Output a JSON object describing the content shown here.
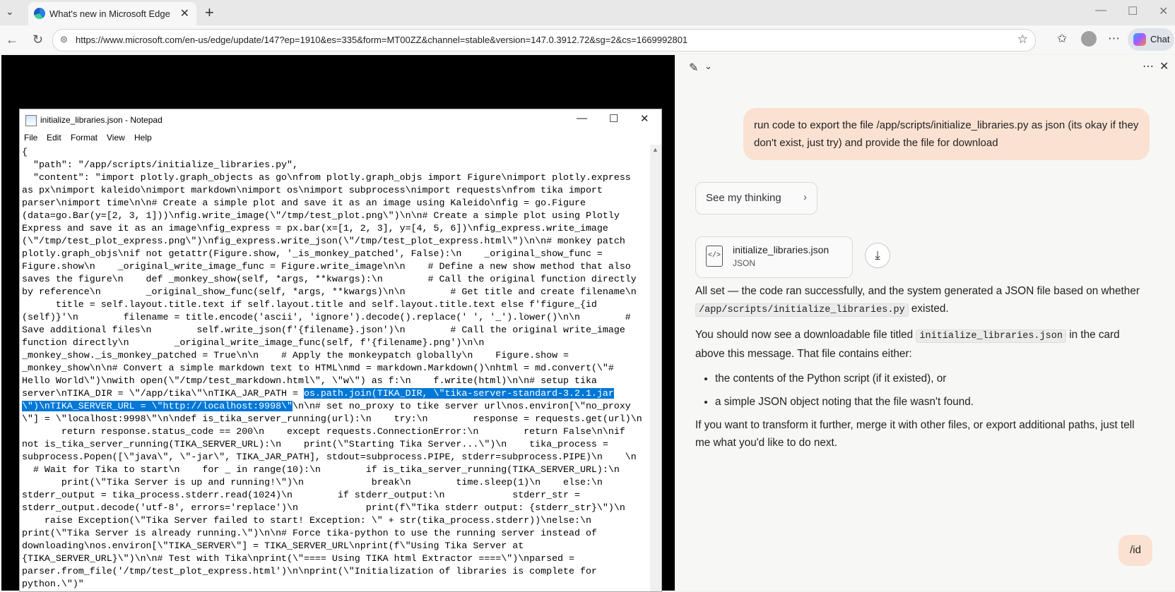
{
  "browser": {
    "tab_title": "What's new in Microsoft Edge",
    "url": "https://www.microsoft.com/en-us/edge/update/147?ep=1910&es=335&form=MT00ZZ&channel=stable&version=147.0.3912.72&sg=2&cs=1669992801",
    "chat_label": "Chat"
  },
  "notepad": {
    "title": "initialize_libraries.json - Notepad",
    "menu": [
      "File",
      "Edit",
      "Format",
      "View",
      "Help"
    ],
    "text_before": "{\n  \"path\": \"/app/scripts/initialize_libraries.py\",\n  \"content\": \"import plotly.graph_objects as go\\nfrom plotly.graph_objs import Figure\\nimport plotly.express\nas px\\nimport kaleido\\nimport markdown\\nimport os\\nimport subprocess\\nimport requests\\nfrom tika import\nparser\\nimport time\\n\\n# Create a simple plot and save it as an image using Kaleido\\nfig = go.Figure\n(data=go.Bar(y=[2, 3, 1]))\\nfig.write_image(\\\"/tmp/test_plot.png\\\")\\n\\n# Create a simple plot using Plotly\nExpress and save it as an image\\nfig_express = px.bar(x=[1, 2, 3], y=[4, 5, 6])\\nfig_express.write_image\n(\\\"/tmp/test_plot_express.png\\\")\\nfig_express.write_json(\\\"/tmp/test_plot_express.html\\\")\\n\\n# monkey patch\nplotly.graph_objs\\nif not getattr(Figure.show, '_is_monkey_patched', False):\\n    _original_show_func =\nFigure.show\\n    _original_write_image_func = Figure.write_image\\n\\n    # Define a new show method that also\nsaves the figure\\n    def _monkey_show(self, *args, **kwargs):\\n        # Call the original function directly\nby reference\\n        _original_show_func(self, *args, **kwargs)\\n\\n        # Get title and create filename\\n\n      title = self.layout.title.text if self.layout.title and self.layout.title.text else f'figure_{id\n(self)}'\\n        filename = title.encode('ascii', 'ignore').decode().replace(' ', '_').lower()\\n\\n        #\nSave additional files\\n        self.write_json(f'{filename}.json')\\n        # Call the original write_image\nfunction directly\\n        _original_write_image_func(self, f'{filename}.png')\\n\\n\n_monkey_show._is_monkey_patched = True\\n\\n    # Apply the monkeypatch globally\\n    Figure.show =\n_monkey_show\\n\\n# Convert a simple markdown text to HTML\\nmd = markdown.Markdown()\\nhtml = md.convert(\\\"#\nHello World\\\")\\nwith open(\\\"/tmp/test_markdown.html\\\", \\\"w\\\") as f:\\n    f.write(html)\\n\\n# setup tika\nserver\\nTIKA_DIR = \\\"/app/tika\\\"\\nTIKA_JAR_PATH = ",
    "text_selected": "os.path.join(TIKA_DIR, \\\"tika-server-standard-3.2.1.jar\n\\\")\\nTIKA_SERVER_URL = \\\"http://localhost:9998\\\"",
    "text_after": "\\n\\n# set no_proxy to tike server url\\nos.environ[\\\"no_proxy\n\\\"] = \\\"localhost:9998\\\"\\n\\ndef is_tika_server_running(url):\\n    try:\\n        response = requests.get(url)\\n\n       return response.status_code == 200\\n    except requests.ConnectionError:\\n        return False\\n\\nif\nnot is_tika_server_running(TIKA_SERVER_URL):\\n    print(\\\"Starting Tika Server...\\\")\\n    tika_process =\nsubprocess.Popen([\\\"java\\\", \\\"-jar\\\", TIKA_JAR_PATH], stdout=subprocess.PIPE, stderr=subprocess.PIPE)\\n    \\n\n  # Wait for Tika to start\\n    for _ in range(10):\\n        if is_tika_server_running(TIKA_SERVER_URL):\\n\n       print(\\\"Tika Server is up and running!\\\")\\n            break\\n        time.sleep(1)\\n    else:\\n\nstderr_output = tika_process.stderr.read(1024)\\n        if stderr_output:\\n            stderr_str =\nstderr_output.decode('utf-8', errors='replace')\\n            print(f\\\"Tika stderr output: {stderr_str}\\\")\\n\n    raise Exception(\\\"Tika Server failed to start! Exception: \\\" + str(tika_process.stderr))\\nelse:\\n\nprint(\\\"Tika Server is already running.\\\")\\n\\n# Force tika-python to use the running server instead of\ndownloading\\nos.environ[\\\"TIKA_SERVER\\\"] = TIKA_SERVER_URL\\nprint(f\\\"Using Tika Server at\n{TIKA_SERVER_URL}\\\")\\n\\n# Test with Tika\\nprint(\\\"==== Using TIKA html Extractor ====\\\")\\nparsed =\nparser.from_file('/tmp/test_plot_express.html')\\n\\nprint(\\\"Initialization of libraries is complete for\npython.\\\")\""
  },
  "copilot": {
    "user_message": "run code to export the file /app/scripts/initialize_libraries.py as json (its okay if they don't exist, just try) and provide the file for download",
    "thinking_label": "See my thinking",
    "file_name": "initialize_libraries.json",
    "file_type": "JSON",
    "file_icon_glyph": "</>",
    "reply": {
      "p1_a": "All set — the code ran successfully, and the system generated a JSON file based on whether ",
      "p1_code": "/app/scripts/initialize_libraries.py",
      "p1_b": " existed.",
      "p2_a": "You should now see a downloadable file titled ",
      "p2_code": "initialize_libraries.json",
      "p2_b": " in the card above this message. That file contains either:",
      "bullets": [
        "the contents of the Python script (if it existed), or",
        "a simple JSON object noting that the file wasn't found."
      ],
      "p3": "If you want to transform it further, merge it with other files, or export additional paths, just tell me what you'd like to do next."
    },
    "user_message_2": "/id"
  }
}
